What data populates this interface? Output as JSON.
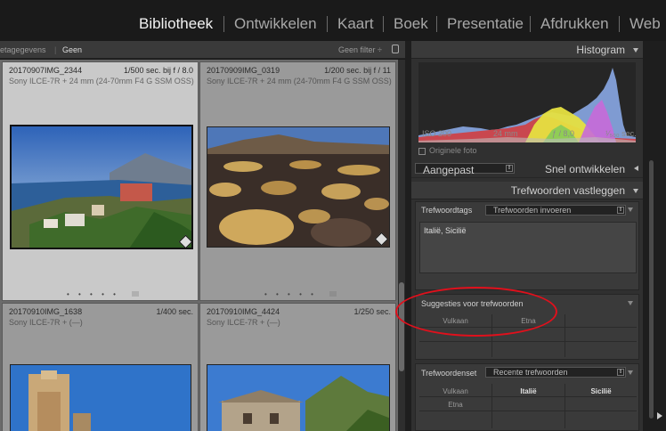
{
  "modules": [
    {
      "label": "Bibliotheek",
      "active": true
    },
    {
      "label": "Ontwikkelen",
      "active": false
    },
    {
      "label": "Kaart",
      "active": false
    },
    {
      "label": "Boek",
      "active": false
    },
    {
      "label": "Presentatie",
      "active": false
    },
    {
      "label": "Afdrukken",
      "active": false
    },
    {
      "label": "Web",
      "active": false
    }
  ],
  "filterbar": {
    "metadata_label": "etagegevens",
    "filter_value": "Geen",
    "preset_label": "Geen filter ÷"
  },
  "grid": {
    "cells": [
      {
        "name": "20170907IMG_2344",
        "exposure": "1/500 sec. bij f / 8.0",
        "camera": "Sony ILCE-7R + 24 mm (24-70mm F4 G SSM OSS)",
        "selected": true
      },
      {
        "name": "20170909IMG_0319",
        "exposure": "1/200 sec. bij f / 11",
        "camera": "Sony ILCE-7R + 24 mm (24-70mm F4 G SSM OSS)",
        "selected": false
      },
      {
        "name": "20170910IMG_1638",
        "exposure": "1/400 sec.",
        "camera": "Sony ILCE-7R + (—)",
        "selected": false
      },
      {
        "name": "20170910IMG_4424",
        "exposure": "1/250 sec.",
        "camera": "Sony ILCE-7R + (—)",
        "selected": false
      }
    ],
    "dots": "• • • • •"
  },
  "histogram": {
    "title": "Histogram",
    "iso": "ISO 200",
    "focal": "24 mm",
    "aperture": "ƒ / 8,0",
    "shutter": "¹⁄₅₀₀ sec.",
    "original_label": "Originele foto"
  },
  "quick_develop": {
    "preset_value": "Aangepast",
    "title": "Snel ontwikkelen"
  },
  "keywording": {
    "title": "Trefwoorden vastleggen",
    "tags_label": "Trefwoordtags",
    "tags_select": "Trefwoorden invoeren",
    "tags_text": "Italië, Sicilië",
    "suggestions_label": "Suggesties voor trefwoorden",
    "suggestions": [
      "Vulkaan",
      "Etna"
    ],
    "set_label": "Trefwoordenset",
    "set_select": "Recente trefwoorden",
    "set_keywords": [
      "Vulkaan",
      "Italië",
      "Sicilië",
      "Etna"
    ]
  },
  "colors": {
    "annotation": "#e0101c",
    "panel": "#303030",
    "grid_bg": "#6b6b6b",
    "selected_cell": "#c9c9c9"
  }
}
